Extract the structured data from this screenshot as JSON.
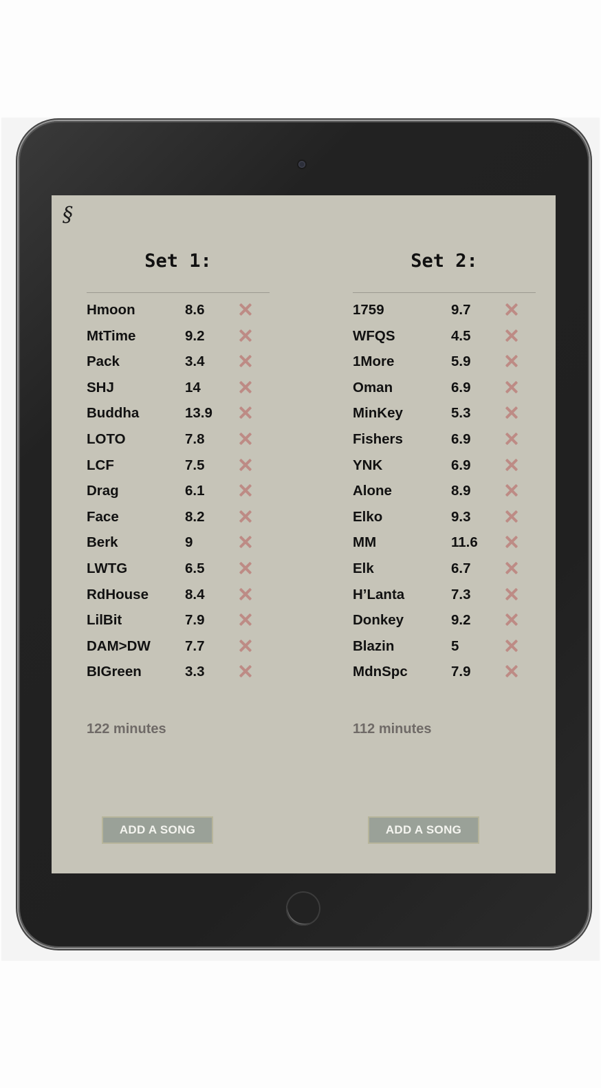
{
  "app": {
    "logo_glyph": "§"
  },
  "sets": [
    {
      "title": "Set 1:",
      "songs": [
        {
          "name": "Hmoon",
          "length": "8.6"
        },
        {
          "name": "MtTime",
          "length": "9.2"
        },
        {
          "name": "Pack",
          "length": "3.4"
        },
        {
          "name": "SHJ",
          "length": "14"
        },
        {
          "name": "Buddha",
          "length": "13.9"
        },
        {
          "name": "LOTO",
          "length": "7.8"
        },
        {
          "name": "LCF",
          "length": "7.5"
        },
        {
          "name": "Drag",
          "length": "6.1"
        },
        {
          "name": "Face",
          "length": "8.2"
        },
        {
          "name": "Berk",
          "length": "9"
        },
        {
          "name": "LWTG",
          "length": "6.5"
        },
        {
          "name": "RdHouse",
          "length": "8.4"
        },
        {
          "name": "LilBit",
          "length": "7.9"
        },
        {
          "name": "DAM>DW",
          "length": "7.7"
        },
        {
          "name": "BIGreen",
          "length": "3.3"
        }
      ],
      "total": "122 minutes",
      "add_label": "ADD A SONG"
    },
    {
      "title": "Set 2:",
      "songs": [
        {
          "name": "1759",
          "length": "9.7"
        },
        {
          "name": "WFQS",
          "length": "4.5"
        },
        {
          "name": "1More",
          "length": "5.9"
        },
        {
          "name": "Oman",
          "length": "6.9"
        },
        {
          "name": "MinKey",
          "length": "5.3"
        },
        {
          "name": "Fishers",
          "length": "6.9"
        },
        {
          "name": "YNK",
          "length": "6.9"
        },
        {
          "name": "Alone",
          "length": "8.9"
        },
        {
          "name": "Elko",
          "length": "9.3"
        },
        {
          "name": "MM",
          "length": "11.6"
        },
        {
          "name": "Elk",
          "length": "6.7"
        },
        {
          "name": "H’Lanta",
          "length": "7.3"
        },
        {
          "name": "Donkey",
          "length": "9.2"
        },
        {
          "name": "Blazin",
          "length": "5"
        },
        {
          "name": "MdnSpc",
          "length": "7.9"
        }
      ],
      "total": "112 minutes",
      "add_label": "ADD A SONG"
    }
  ],
  "icons": {
    "remove": "close-icon"
  },
  "colors": {
    "screen_bg": "#c6c4b8",
    "remove_icon": "#bd8b85",
    "button_bg": "#9aa198",
    "total_text": "#6f6a67"
  }
}
